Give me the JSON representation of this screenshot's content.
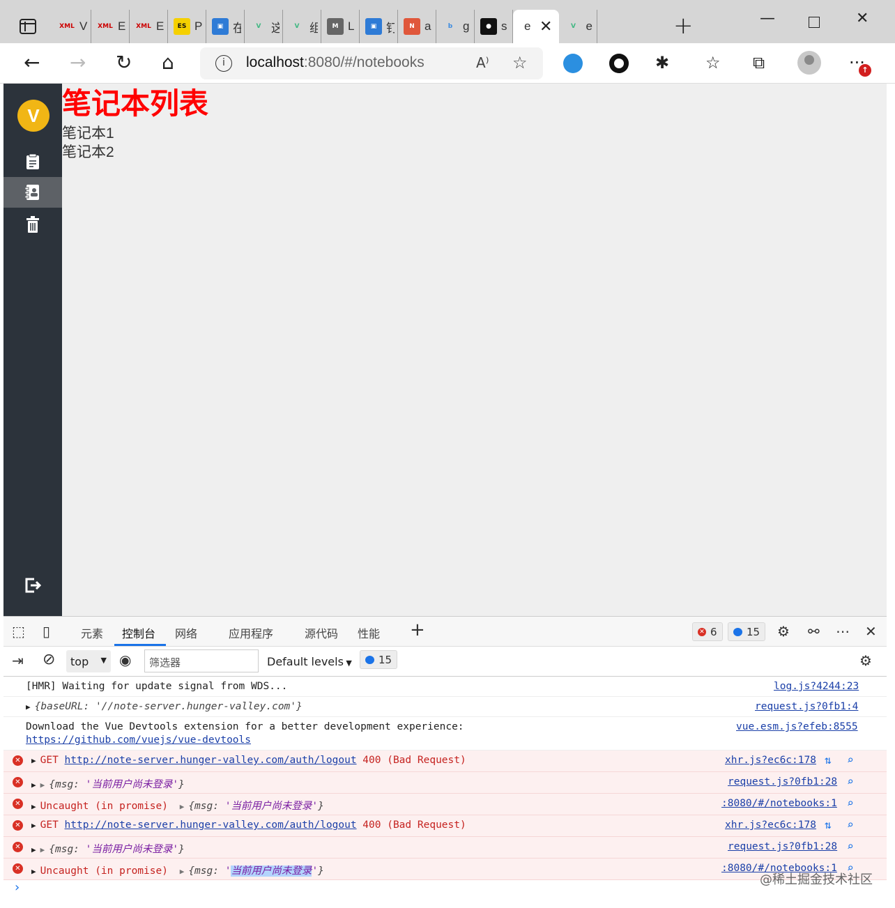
{
  "browser": {
    "tabs": [
      {
        "icon": "xml-icon",
        "label": "V",
        "fav_text": "XML"
      },
      {
        "icon": "xml-icon",
        "label": "E",
        "fav_text": "XML"
      },
      {
        "icon": "xml-icon",
        "label": "E",
        "fav_text": "XML"
      },
      {
        "icon": "es-icon",
        "label": "P",
        "fav_text": "ES"
      },
      {
        "icon": "app-icon",
        "label": "在",
        "fav_text": ""
      },
      {
        "icon": "vue-icon",
        "label": "这",
        "fav_text": ""
      },
      {
        "icon": "vue-icon",
        "label": "组",
        "fav_text": ""
      },
      {
        "icon": "m-icon",
        "label": "L",
        "fav_text": "M"
      },
      {
        "icon": "app-icon",
        "label": "钉",
        "fav_text": ""
      },
      {
        "icon": "n-icon",
        "label": "a",
        "fav_text": ""
      },
      {
        "icon": "bing-icon",
        "label": "g",
        "fav_text": ""
      },
      {
        "icon": "github-icon",
        "label": "s",
        "fav_text": ""
      },
      {
        "icon": "page-icon",
        "label": "e",
        "fav_text": "",
        "active": true
      },
      {
        "icon": "vue-icon",
        "label": "e",
        "fav_text": ""
      }
    ],
    "url_host": "localhost",
    "url_path": ":8080/#/notebooks"
  },
  "app": {
    "logo_letter": "V",
    "nav": [
      "notes-icon",
      "notebook-icon",
      "trash-icon"
    ],
    "logout_icon": "logout-icon"
  },
  "page": {
    "title": "笔记本列表",
    "notebooks": [
      "笔记本1",
      "笔记本2"
    ]
  },
  "devtools": {
    "tabs": [
      "元素",
      "控制台",
      "网络",
      "应用程序",
      "源代码",
      "性能"
    ],
    "active_tab": "控制台",
    "error_count": "6",
    "message_count": "15",
    "context": "top",
    "filter_placeholder": "筛选器",
    "levels": "Default levels",
    "bar_message_count": "15"
  },
  "console": {
    "hmr": "[HMR] Waiting for update signal from WDS...",
    "hmr_src": "log.js?4244:23",
    "base_obj_key": "{baseURL: ",
    "base_obj_val": "'//note-server.hunger-valley.com'",
    "base_obj_end": "}",
    "base_src": "request.js?0fb1:4",
    "devtools_msg": "Download the Vue Devtools extension for a better development experience:",
    "devtools_link": "https://github.com/vuejs/vue-devtools",
    "devtools_src": "vue.esm.js?efeb:8555",
    "get_prefix": "GET ",
    "logout_url": "http://note-server.hunger-valley.com/auth/logout",
    "status_text": " 400 (Bad Request)",
    "xhr_src": "xhr.js?ec6c:178",
    "msg_key": "{msg: ",
    "msg_val": "'当前用户尚未登录'",
    "msg_end": "}",
    "req_src": "request.js?0fb1:28",
    "uncaught": "Uncaught (in promise) ",
    "notebooks_src": ":8080/#/notebooks:1",
    "msg_val_hl": "当前用户尚未登录"
  },
  "watermark": "@稀土掘金技术社区"
}
